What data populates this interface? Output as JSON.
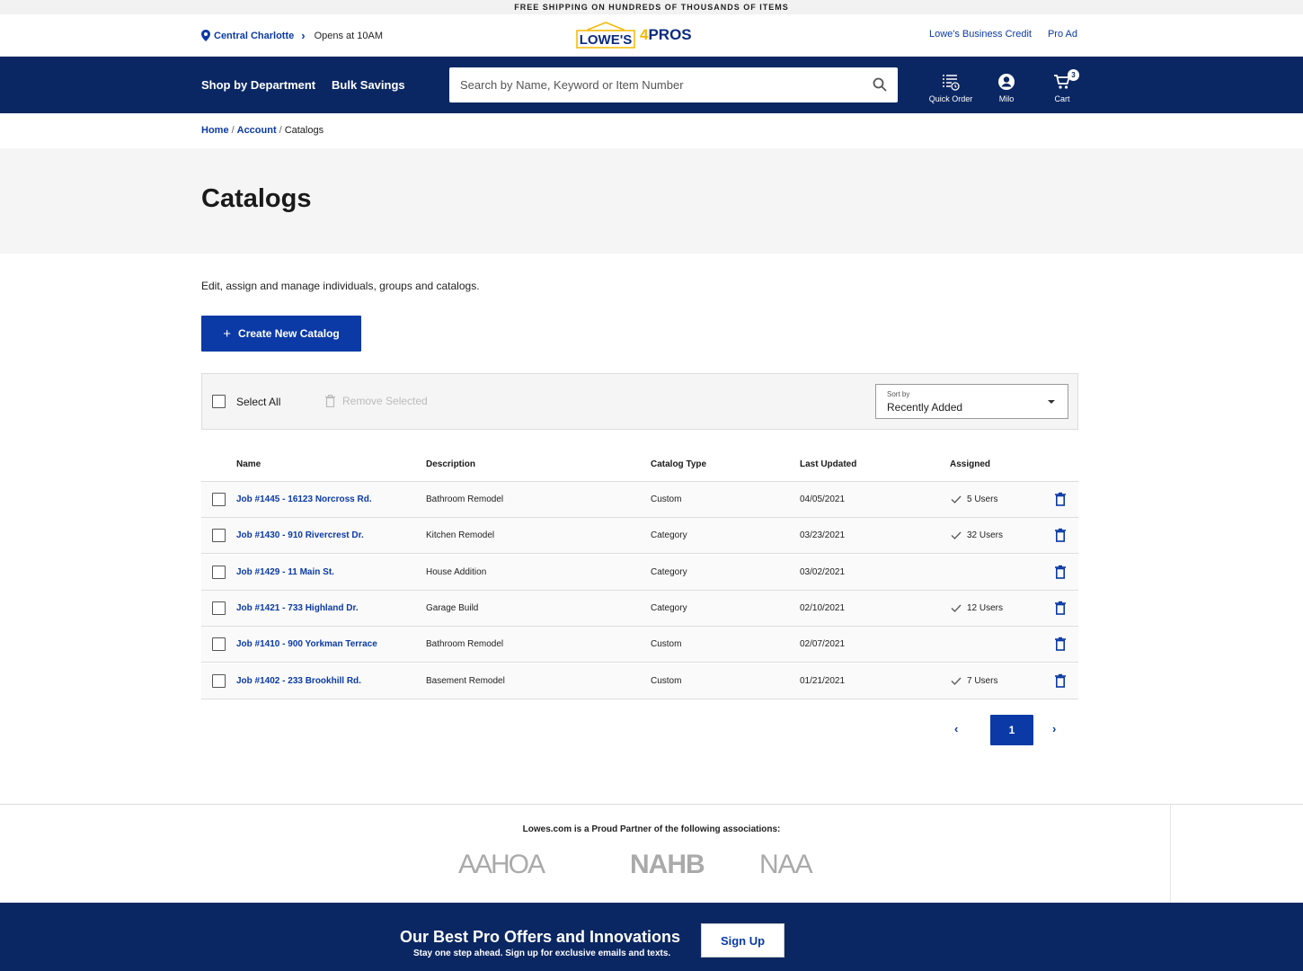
{
  "promo_bar": {
    "text": "FREE SHIPPING ON HUNDREDS OF THOUSANDS OF ITEMS"
  },
  "utility": {
    "store_name": "Central Charlotte",
    "hours": "Opens at 10AM",
    "logo_lowes": "LOWE'S",
    "logo_pros_num": "4",
    "logo_pros_text": "PROS",
    "links": [
      "Lowe's Business Credit",
      "Pro Ad"
    ]
  },
  "nav": {
    "shop_by_department": "Shop by Department",
    "bulk_savings": "Bulk Savings",
    "search_placeholder": "Search by Name, Keyword or Item Number",
    "quick_order": "Quick Order",
    "account": "Milo",
    "cart": "Cart",
    "cart_count": "3"
  },
  "breadcrumb": {
    "home": "Home",
    "account": "Account",
    "current": "Catalogs",
    "separator": "/"
  },
  "page": {
    "title": "Catalogs",
    "intro": "Edit, assign and manage individuals, groups and catalogs.",
    "create_button": "Create New Catalog",
    "create_plus": "+"
  },
  "toolbar": {
    "select_all": "Select All",
    "remove_selected": "Remove Selected",
    "sort_label": "Sort by",
    "sort_value": "Recently Added"
  },
  "table": {
    "headers": {
      "name": "Name",
      "description": "Description",
      "type": "Catalog Type",
      "updated": "Last Updated",
      "assigned": "Assigned"
    },
    "rows": [
      {
        "name": "Job #1445 - 16123 Norcross Rd.",
        "description": "Bathroom Remodel",
        "type": "Custom",
        "updated": "04/05/2021",
        "assigned": "5 Users"
      },
      {
        "name": "Job #1430 - 910 Rivercrest Dr.",
        "description": "Kitchen Remodel",
        "type": "Category",
        "updated": "03/23/2021",
        "assigned": "32 Users"
      },
      {
        "name": "Job #1429 - 11 Main St.",
        "description": "House Addition",
        "type": "Category",
        "updated": "03/02/2021",
        "assigned": ""
      },
      {
        "name": "Job #1421 - 733 Highland Dr.",
        "description": "Garage Build",
        "type": "Category",
        "updated": "02/10/2021",
        "assigned": "12 Users"
      },
      {
        "name": "Job #1410 - 900 Yorkman Terrace",
        "description": "Bathroom Remodel",
        "type": "Custom",
        "updated": "02/07/2021",
        "assigned": ""
      },
      {
        "name": "Job #1402 - 233 Brookhill Rd.",
        "description": "Basement Remodel",
        "type": "Custom",
        "updated": "01/21/2021",
        "assigned": "7 Users"
      }
    ]
  },
  "pagination": {
    "prev": "‹",
    "current": "1",
    "next": "›"
  },
  "partners": {
    "title": "Lowes.com is a Proud Partner of the following associations:",
    "logos": [
      "AAHOA",
      "NAHB",
      "NAA"
    ]
  },
  "footer": {
    "title": "Our Best Pro Offers and Innovations",
    "subtitle": "Stay one step ahead. Sign up for exclusive emails and texts.",
    "signup": "Sign Up"
  },
  "colors": {
    "brand_blue": "#0b3aa6",
    "nav_navy": "#0b2763",
    "logo_yellow": "#f5b800"
  }
}
